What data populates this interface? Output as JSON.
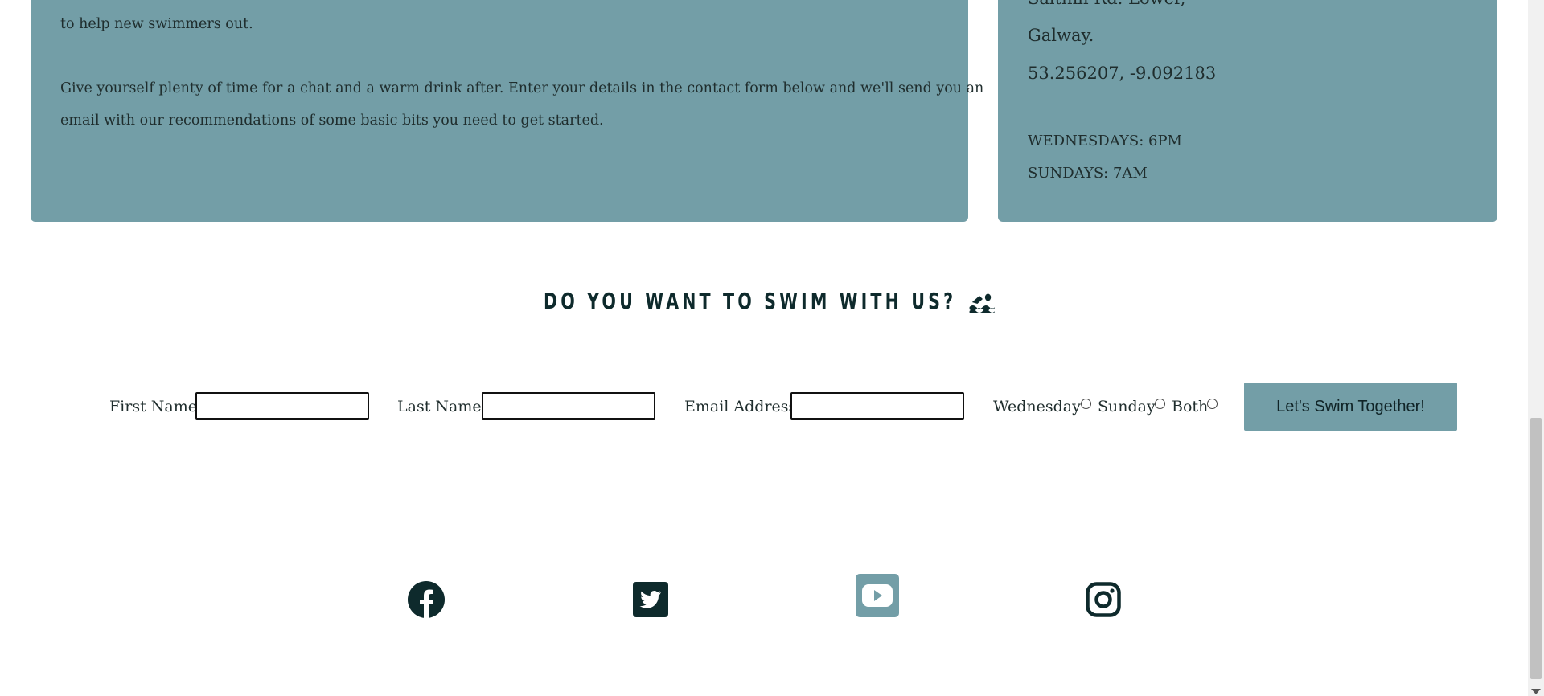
{
  "info": {
    "paragraph_1": "to help new swimmers out.",
    "paragraph_2_line_1": "Give yourself plenty of time for a chat and a warm drink after. Enter your details in the contact form below and we'll send you an",
    "paragraph_2_line_2": "email with our recommendations of some basic bits you need to get started."
  },
  "location": {
    "address_line_1": "Salthill Rd. Lower,",
    "address_line_2": "Galway.",
    "coordinates": "53.256207, -9.092183",
    "schedule_1": "WEDNESDAYS: 6PM",
    "schedule_2": "SUNDAYS: 7AM"
  },
  "signup": {
    "heading": "DO YOU WANT TO SWIM WITH US?",
    "first_name_label": "First Name",
    "last_name_label": "Last Name",
    "email_label": "Email Address",
    "option_wednesday": "Wednesday",
    "option_sunday": "Sunday",
    "option_both": "Both",
    "submit_label": "Let's Swim Together!"
  },
  "social": {
    "icons": [
      "facebook-icon",
      "twitter-icon",
      "youtube-icon",
      "instagram-icon"
    ]
  },
  "colors": {
    "card_background": "#739ea7",
    "dark_text": "#0e2a2c",
    "youtube_tile": "#739ea7"
  }
}
